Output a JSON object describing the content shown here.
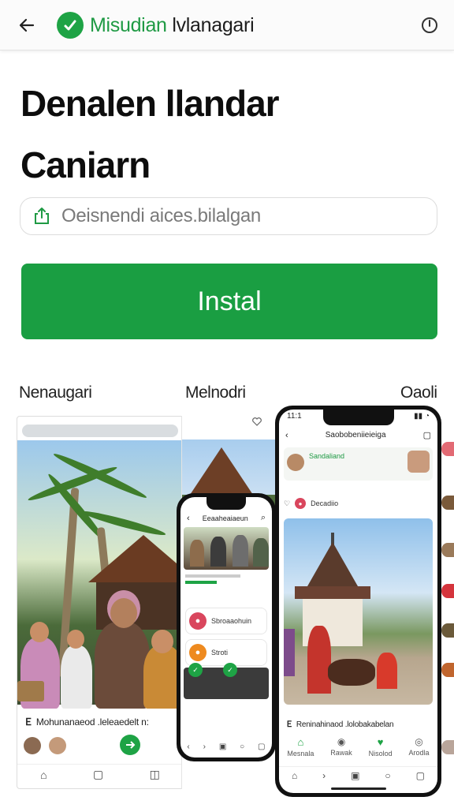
{
  "header": {
    "brand_part1": "Misudian",
    "brand_part2": "lvlanagari"
  },
  "title": {
    "line1": "Denalen llandar",
    "line2": "Caniarn"
  },
  "field": {
    "value": "Oeisnendi aices.bilalgan"
  },
  "install": {
    "label": "Instal"
  },
  "categories": [
    "Nenaugari",
    "Melnodri",
    "Oaoli"
  ],
  "screens": {
    "card1_caption": "Mohunanaeod .leleaedelt n:",
    "phone_small": {
      "header_title": "Eeaaheaiaeun",
      "row1": "Sbroaaohuin",
      "row2": "Stroti"
    },
    "phone_big": {
      "time": "11:1",
      "header_title": "Saobobeniieieiga",
      "banner": "Sandaliand",
      "like_text": "Decadiio",
      "caption": "Reninahinaod .lolobakabelan",
      "tabs": [
        "Mesnala",
        "Rawak",
        "Nisolod",
        "Arodla"
      ]
    }
  },
  "colors": {
    "brand_green": "#1a9e42",
    "text_dark": "#111111",
    "muted": "#7a7a7a"
  }
}
